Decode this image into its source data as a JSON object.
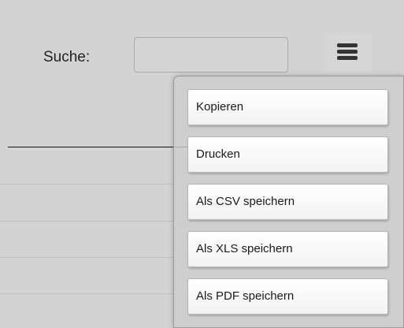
{
  "search": {
    "label": "Suche:",
    "value": "",
    "placeholder": ""
  },
  "menu_button": {
    "icon": "hamburger-menu-icon"
  },
  "export_menu": {
    "items": [
      {
        "label": "Kopieren"
      },
      {
        "label": "Drucken"
      },
      {
        "label": "Als CSV speichern"
      },
      {
        "label": "Als XLS speichern"
      },
      {
        "label": "Als PDF speichern"
      }
    ]
  },
  "colors": {
    "background": "#d3d3d3",
    "menu_item_bg": "#ffffff",
    "text": "#1a1a1a",
    "icon": "#333333"
  }
}
